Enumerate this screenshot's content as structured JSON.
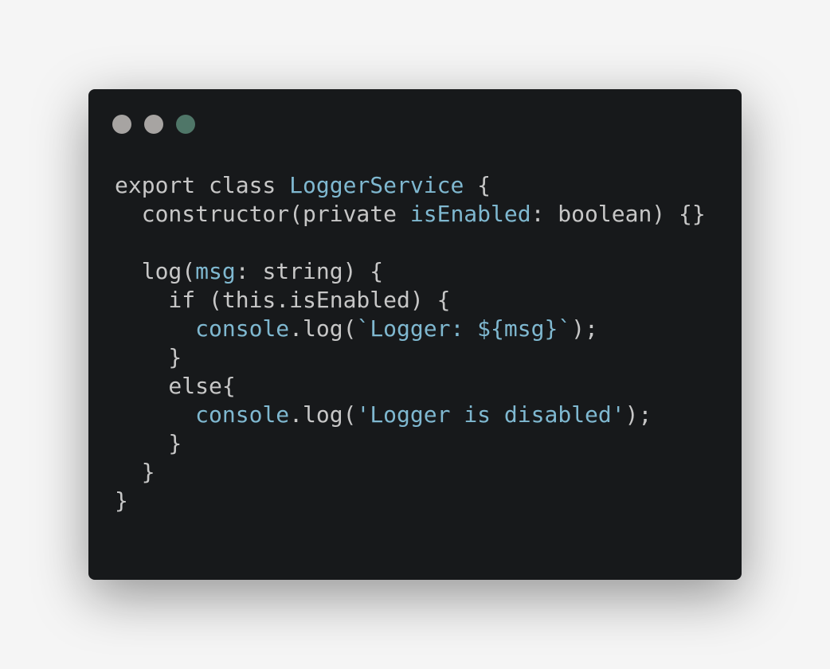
{
  "window": {
    "dots": [
      {
        "name": "close-dot",
        "color": "#a7a4a2"
      },
      {
        "name": "minimize-dot",
        "color": "#a7a4a2"
      },
      {
        "name": "maximize-dot",
        "color": "#4f7668"
      }
    ]
  },
  "colors": {
    "page_background": "#f5f5f5",
    "window_background": "#17191b",
    "text": "#c7c7c7",
    "identifier": "#7fb8d0"
  },
  "code": {
    "lines": [
      [
        {
          "t": "export class ",
          "k": "plain"
        },
        {
          "t": "LoggerService",
          "k": "ident"
        },
        {
          "t": " {",
          "k": "plain"
        }
      ],
      [
        {
          "t": "  constructor(private ",
          "k": "plain"
        },
        {
          "t": "isEnabled",
          "k": "ident"
        },
        {
          "t": ": boolean) {}",
          "k": "plain"
        }
      ],
      [],
      [
        {
          "t": "  log(",
          "k": "plain"
        },
        {
          "t": "msg",
          "k": "ident"
        },
        {
          "t": ": string) {",
          "k": "plain"
        }
      ],
      [
        {
          "t": "    if (this.isEnabled) {",
          "k": "plain"
        }
      ],
      [
        {
          "t": "      ",
          "k": "plain"
        },
        {
          "t": "console",
          "k": "ident"
        },
        {
          "t": ".log(",
          "k": "plain"
        },
        {
          "t": "`Logger: ${msg}`",
          "k": "ident"
        },
        {
          "t": ");",
          "k": "plain"
        }
      ],
      [
        {
          "t": "    }",
          "k": "plain"
        }
      ],
      [
        {
          "t": "    else{",
          "k": "plain"
        }
      ],
      [
        {
          "t": "      ",
          "k": "plain"
        },
        {
          "t": "console",
          "k": "ident"
        },
        {
          "t": ".log(",
          "k": "plain"
        },
        {
          "t": "'Logger is disabled'",
          "k": "ident"
        },
        {
          "t": ");",
          "k": "plain"
        }
      ],
      [
        {
          "t": "    }",
          "k": "plain"
        }
      ],
      [
        {
          "t": "  }",
          "k": "plain"
        }
      ],
      [
        {
          "t": "}",
          "k": "plain"
        }
      ]
    ]
  }
}
